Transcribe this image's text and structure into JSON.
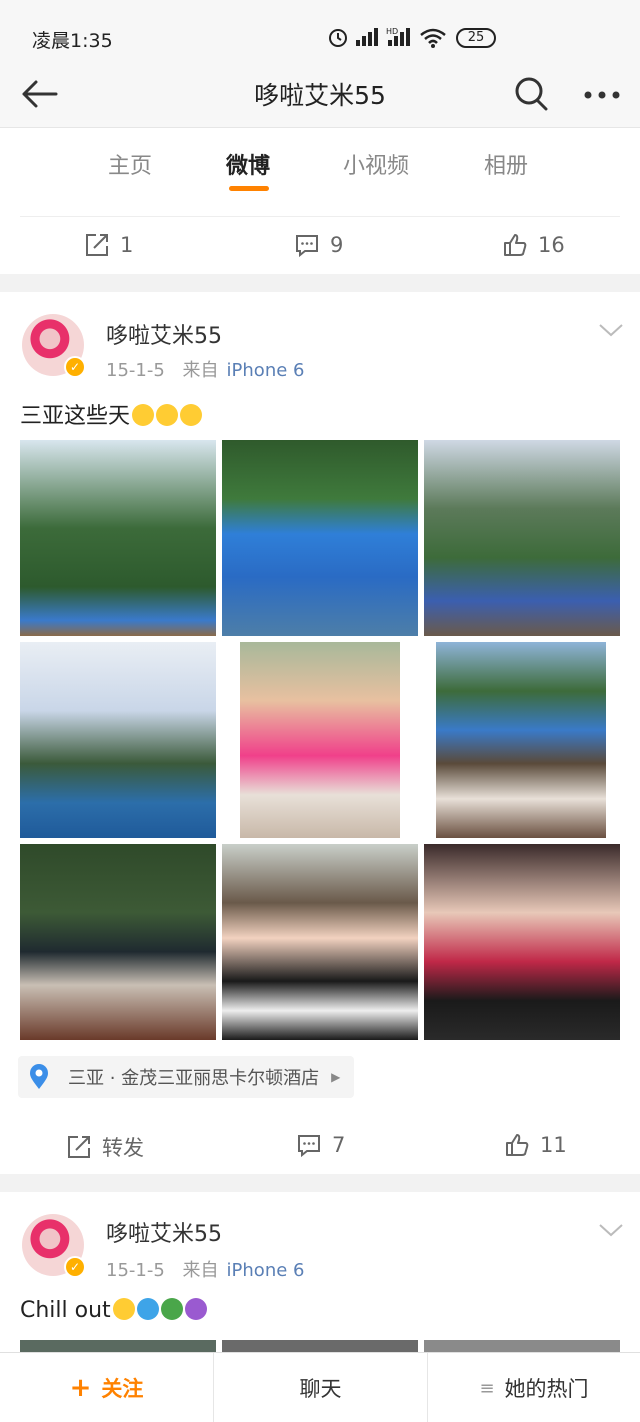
{
  "status_bar": {
    "time": "凌晨1:35",
    "battery": "25"
  },
  "navbar": {
    "title": "哆啦艾米55"
  },
  "tabs": [
    {
      "label": "主页"
    },
    {
      "label": "微博"
    },
    {
      "label": "小视频"
    },
    {
      "label": "相册"
    }
  ],
  "prev_post_actions": {
    "repost": "1",
    "comment": "9",
    "like": "16"
  },
  "posts": [
    {
      "username": "哆啦艾米55",
      "date": "15-1-5",
      "from_label": "来自",
      "device": "iPhone 6",
      "text": "三亚这些天",
      "location": "三亚 · 金茂三亚丽思卡尔顿酒店",
      "actions": {
        "repost": "转发",
        "comment": "7",
        "like": "11"
      }
    },
    {
      "username": "哆啦艾米55",
      "date": "15-1-5",
      "from_label": "来自",
      "device": "iPhone 6",
      "text": "Chill out"
    }
  ],
  "bottom_bar": {
    "follow": "关注",
    "chat": "聊天",
    "hot": "她的热门"
  },
  "colors": {
    "accent": "#ff8200",
    "device_link": "#5a7fb5",
    "verified": "#ffb000"
  }
}
